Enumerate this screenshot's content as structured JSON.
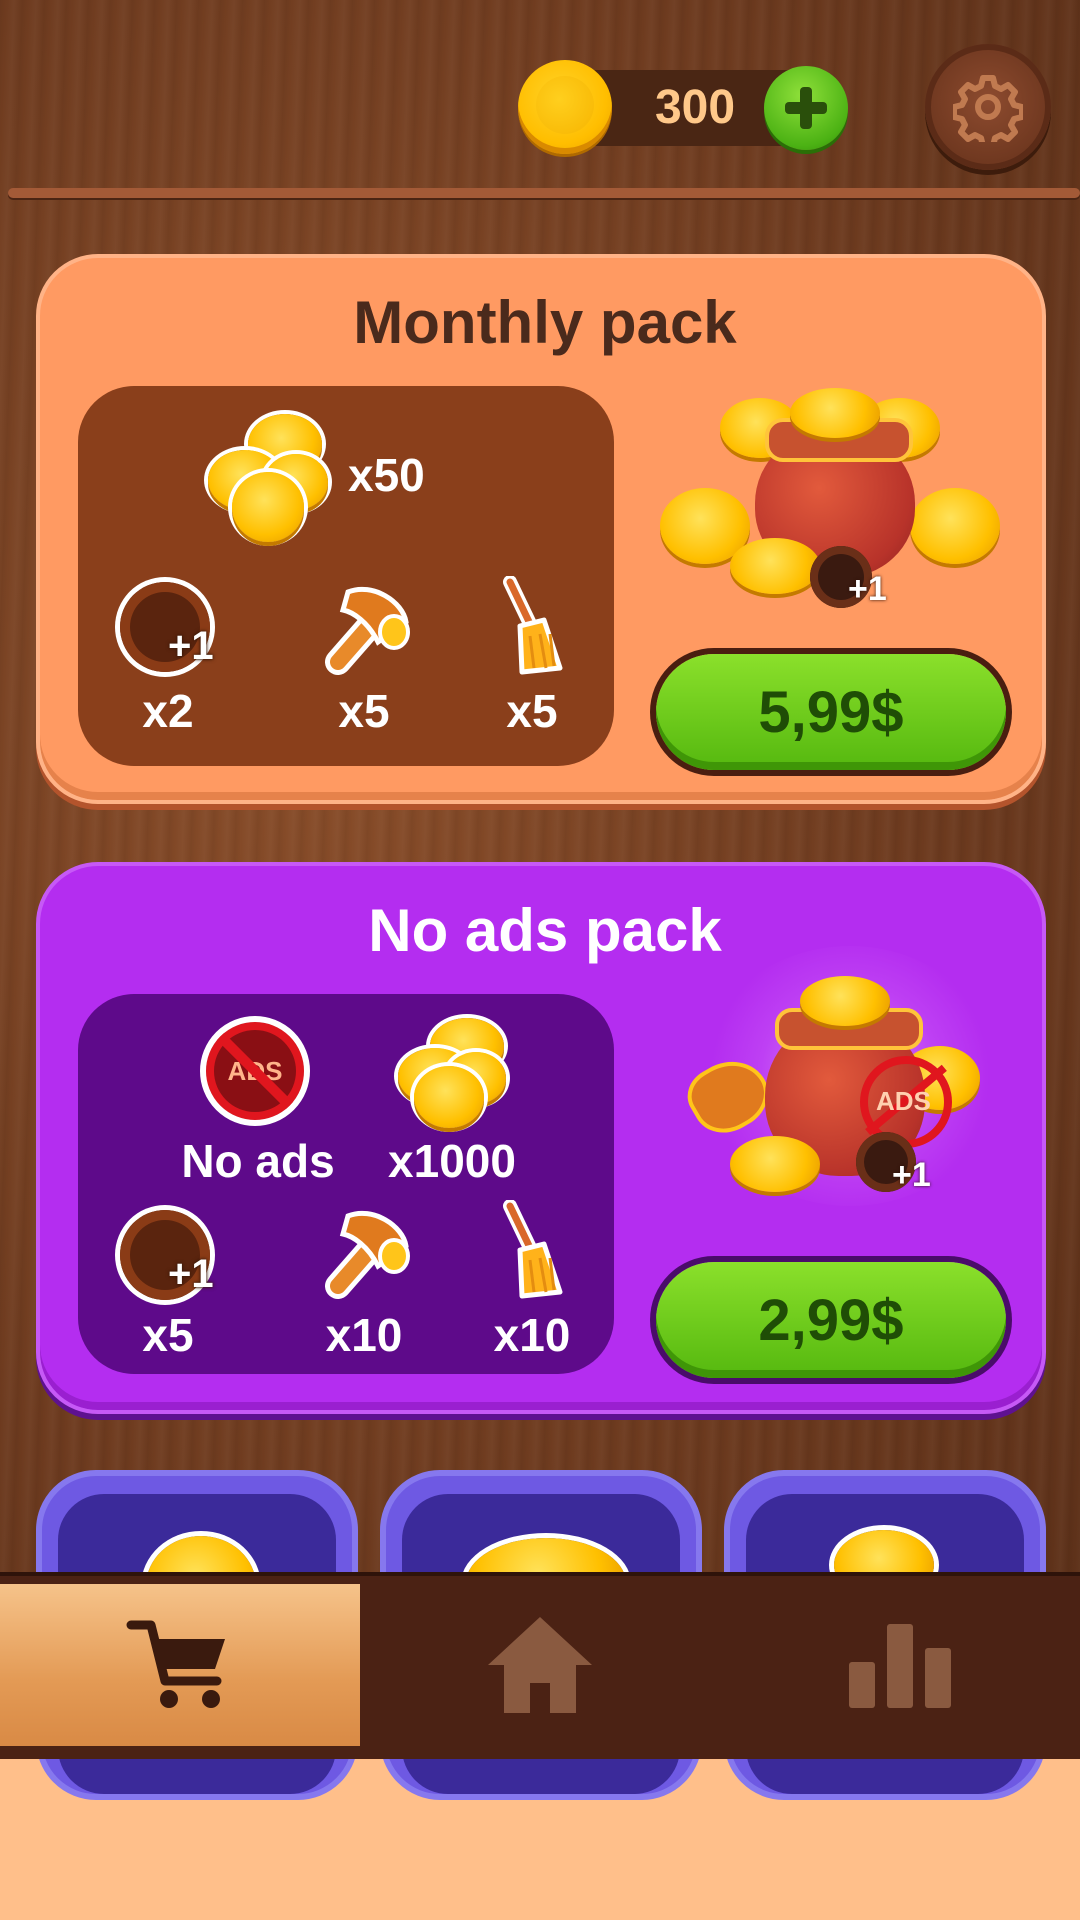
{
  "header": {
    "coin_count": "300",
    "coin_icon": "coin-icon",
    "add_coins_icon": "plus-icon",
    "settings_icon": "gear-icon"
  },
  "monthly_pack": {
    "title": "Monthly pack",
    "coins_qty": "x50",
    "items": [
      {
        "icon": "hole-plus-one-icon",
        "badge": "+1",
        "qty": "x2"
      },
      {
        "icon": "hammer-icon",
        "qty": "x5"
      },
      {
        "icon": "broom-icon",
        "qty": "x5"
      }
    ],
    "reward_badge": "+1",
    "price": "5,99$"
  },
  "no_ads_pack": {
    "title": "No ads pack",
    "no_ads_badge": "ADS",
    "no_ads_label": "No ads",
    "coins_qty": "x1000",
    "items": [
      {
        "icon": "hole-plus-one-icon",
        "badge": "+1",
        "qty": "x5"
      },
      {
        "icon": "hammer-icon",
        "qty": "x10"
      },
      {
        "icon": "broom-icon",
        "qty": "x10"
      }
    ],
    "reward_badge": "+1",
    "reward_ads_badge": "ADS",
    "price": "2,99$"
  },
  "bottom_nav": {
    "tabs": [
      {
        "icon": "cart-icon",
        "active": true
      },
      {
        "icon": "home-icon",
        "active": false
      },
      {
        "icon": "leaderboard-icon",
        "active": false
      }
    ]
  },
  "colors": {
    "monthly_card": "#ff9a62",
    "no_ads_card": "#b42df0",
    "price_button": "#6fcc1c",
    "wood": "#6e3b1f"
  }
}
